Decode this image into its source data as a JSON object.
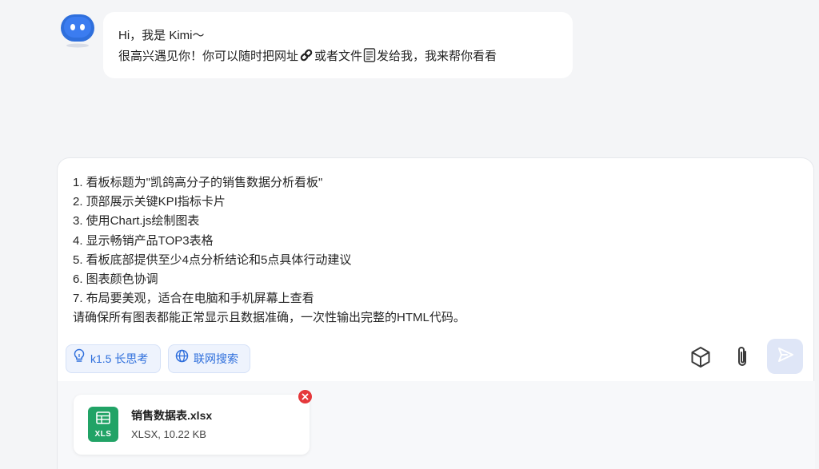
{
  "assistant": {
    "greeting_line1": "Hi，我是 Kimi～",
    "greeting_part1": "很高兴遇见你！你可以随时把网址",
    "greeting_part2": "或者文件",
    "greeting_part3": "发给我，我来帮你看看"
  },
  "composer": {
    "prompt_lines": [
      "1. 看板标题为\"凯鸽高分子的销售数据分析看板\"",
      "2. 顶部展示关键KPI指标卡片",
      "3. 使用Chart.js绘制图表",
      "4. 显示畅销产品TOP3表格",
      "5. 看板底部提供至少4点分析结论和5点具体行动建议",
      "6. 图表颜色协调",
      "7. 布局要美观，适合在电脑和手机屏幕上查看",
      "请确保所有图表都能正常显示且数据准确，一次性输出完整的HTML代码。"
    ],
    "chips": {
      "think_label": "k1.5 长思考",
      "search_label": "联网搜索"
    }
  },
  "attachment": {
    "file_name": "销售数据表.xlsx",
    "file_meta": "XLSX, 10.22 KB",
    "icon_label": "XLS"
  },
  "icons": {
    "avatar": "kimi-avatar-icon",
    "link": "link-icon",
    "document": "document-icon",
    "think": "lightbulb-icon",
    "search": "globe-icon",
    "cube": "cube-icon",
    "clip": "paperclip-icon",
    "send": "send-icon",
    "remove": "close-icon"
  },
  "colors": {
    "accent": "#2f6fdc",
    "excel_green": "#21a366",
    "remove_red": "#e5383b",
    "send_disabled_bg": "#dfe6f7"
  }
}
